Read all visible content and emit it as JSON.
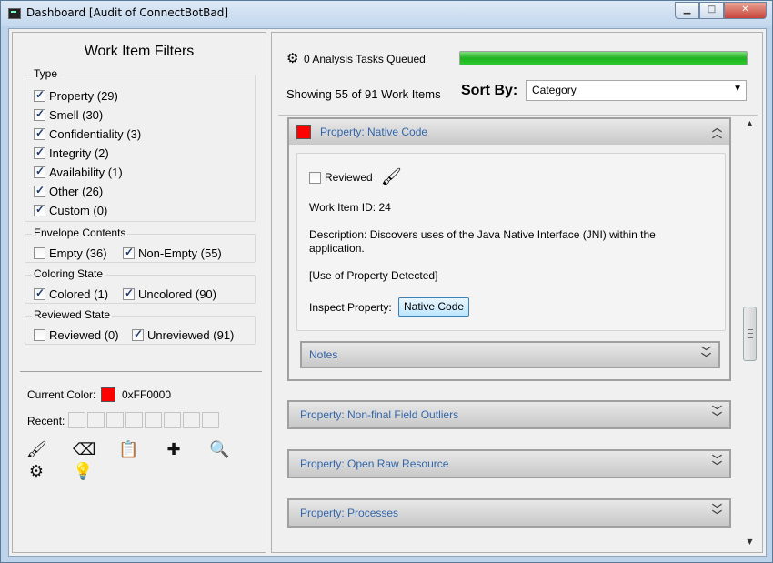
{
  "window": {
    "title": "Dashboard [Audit of ConnectBotBad]",
    "min_glyph": "▁",
    "max_glyph": "□",
    "close_glyph": "✕"
  },
  "filters": {
    "title": "Work Item Filters",
    "type": {
      "label": "Type",
      "items": [
        {
          "label": "Property (29)",
          "checked": true
        },
        {
          "label": "Smell (30)",
          "checked": true
        },
        {
          "label": "Confidentiality (3)",
          "checked": true
        },
        {
          "label": "Integrity (2)",
          "checked": true
        },
        {
          "label": "Availability (1)",
          "checked": true
        },
        {
          "label": "Other (26)",
          "checked": true
        },
        {
          "label": "Custom (0)",
          "checked": true
        }
      ]
    },
    "envelope": {
      "label": "Envelope Contents",
      "items": [
        {
          "label": "Empty (36)",
          "checked": false
        },
        {
          "label": "Non-Empty (55)",
          "checked": true
        }
      ]
    },
    "coloring": {
      "label": "Coloring State",
      "items": [
        {
          "label": "Colored (1)",
          "checked": true
        },
        {
          "label": "Uncolored (90)",
          "checked": true
        }
      ]
    },
    "reviewed": {
      "label": "Reviewed State",
      "items": [
        {
          "label": "Reviewed (0)",
          "checked": false
        },
        {
          "label": "Unreviewed (91)",
          "checked": true
        }
      ]
    }
  },
  "color": {
    "current_label": "Current Color:",
    "current_value": "0xFF0000",
    "current_hex": "#ff0000",
    "recent_label": "Recent:",
    "recent_slots": 8
  },
  "tools": [
    {
      "name": "paintbrush-icon",
      "glyph": "🖌"
    },
    {
      "name": "eraser-icon",
      "glyph": "⌫"
    },
    {
      "name": "clipboard-edit-icon",
      "glyph": "📋"
    },
    {
      "name": "plus-icon",
      "glyph": "✚"
    },
    {
      "name": "search-icon",
      "glyph": "🔍"
    },
    {
      "name": "gear-icon",
      "glyph": "⚙"
    },
    {
      "name": "lightbulb-icon",
      "glyph": "💡"
    }
  ],
  "status": {
    "tasks": "0 Analysis Tasks Queued",
    "progress": 1.0,
    "showing": "Showing 55 of 91 Work Items",
    "sort_label": "Sort By:",
    "sort_value": "Category"
  },
  "work_items": {
    "expanded": {
      "title": "Property: Native Code",
      "color_hex": "#ff0000",
      "reviewed_label": "Reviewed",
      "reviewed": false,
      "id_text": "Work Item ID: 24",
      "description_line1": "Description: Discovers uses of the Java Native Interface (JNI) within the",
      "description_line2": "application.",
      "detected": "[Use of Property Detected]",
      "inspect_label": "Inspect Property:",
      "inspect_button": "Native Code",
      "notes_label": "Notes"
    },
    "collapsed": [
      {
        "title": "Property: Non-final Field Outliers"
      },
      {
        "title": "Property: Open Raw Resource"
      },
      {
        "title": "Property: Processes"
      }
    ]
  }
}
